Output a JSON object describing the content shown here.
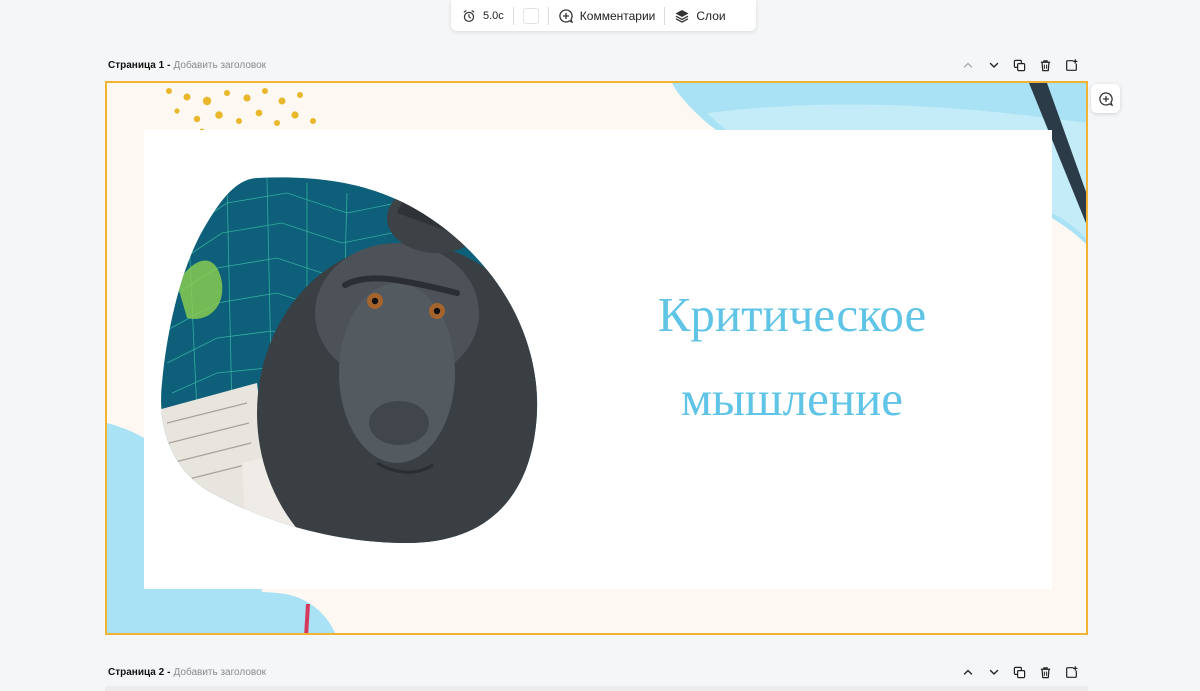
{
  "toolbar": {
    "timer_label": "5.0с",
    "comments_label": "Комментарии",
    "layers_label": "Слои",
    "icons": [
      "alarm-clock-icon",
      "comment-plus-icon",
      "layers-icon"
    ]
  },
  "pages": [
    {
      "title": "Страница 1",
      "separator": "-",
      "add_title_placeholder": "Добавить заголовок",
      "slide": {
        "title_line1": "Критическое",
        "title_line2": "мышление",
        "title_color": "#5fc4e6",
        "border_color": "#f2b233"
      }
    },
    {
      "title": "Страница 2",
      "separator": "-",
      "add_title_placeholder": "Добавить заголовок"
    }
  ],
  "page_actions_icons": [
    "chevron-up-icon",
    "chevron-down-icon",
    "duplicate-icon",
    "trash-icon",
    "add-page-icon"
  ],
  "colors": {
    "accent_border": "#f2b233",
    "title_blue": "#5fc4e6",
    "shape_blue": "#a8e2f4",
    "dots_yellow": "#e8b72c"
  }
}
